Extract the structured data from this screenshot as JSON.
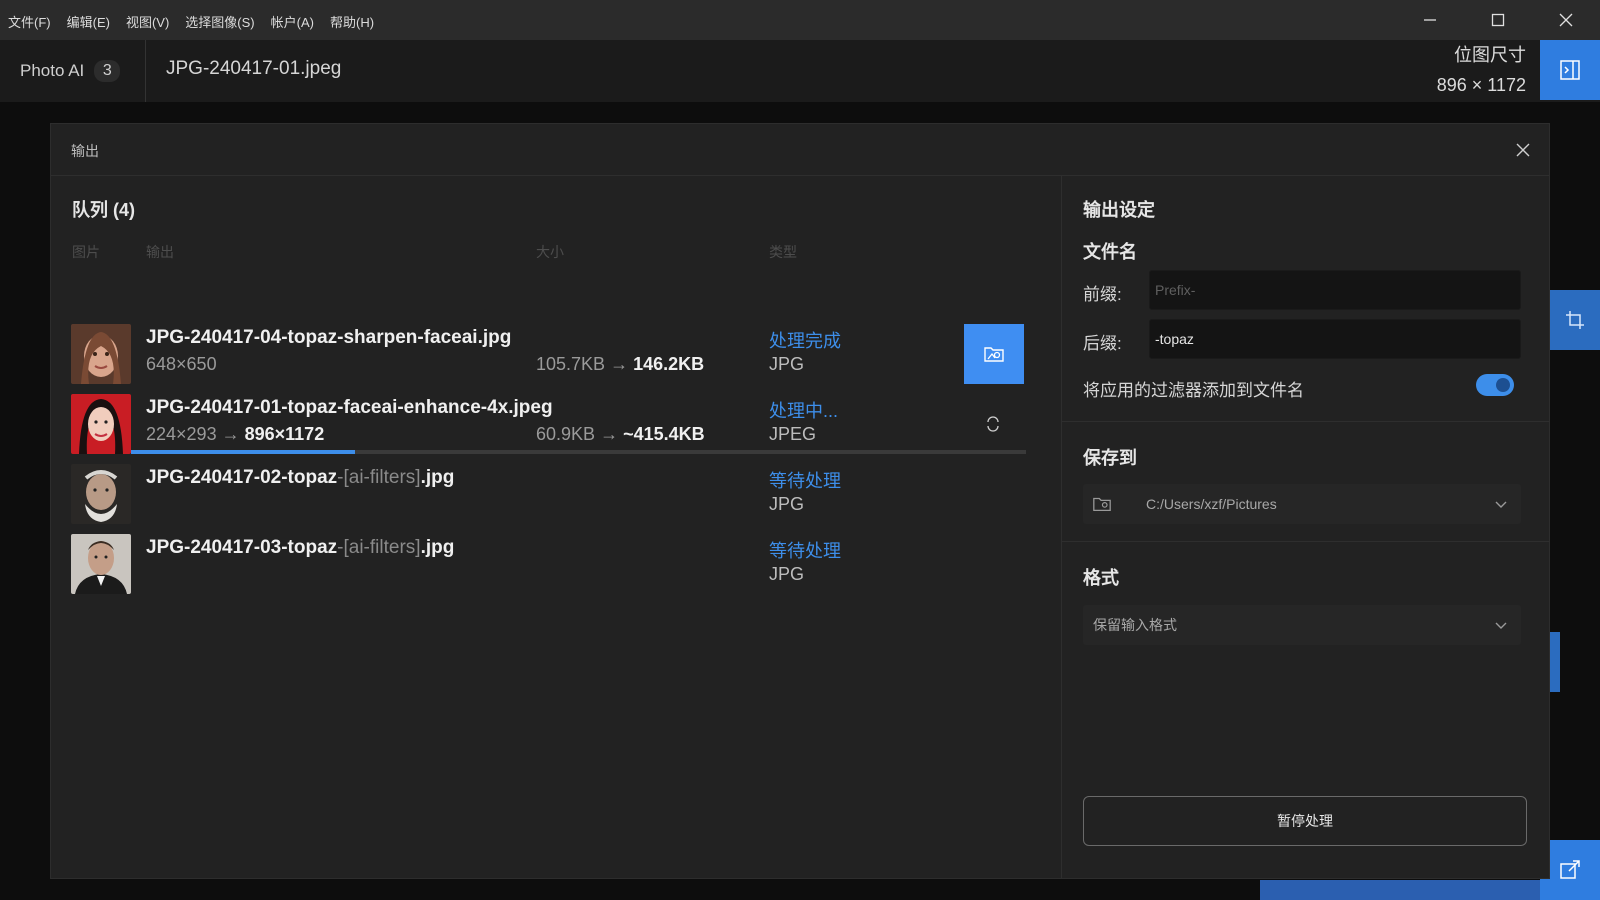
{
  "menu": [
    "文件(F)",
    "编辑(E)",
    "视图(V)",
    "选择图像(S)",
    "帐户(A)",
    "帮助(H)"
  ],
  "app": {
    "name": "Photo AI",
    "count": "3"
  },
  "file_title": "JPG-240417-01.jpeg",
  "bitmap": {
    "label": "位图尺寸",
    "value": "896 × 1172"
  },
  "dialog": {
    "title": "输出"
  },
  "queue": {
    "title": "队列 (4)",
    "columns": {
      "image": "图片",
      "output": "输出",
      "size": "大小",
      "type": "类型"
    },
    "rows": [
      {
        "name": "JPG-240417-04-topaz-sharpen-faceai.jpg",
        "name_suffix": "",
        "dims_from": "648×650",
        "dims_to": "",
        "size_from": "105.7KB",
        "size_to": "146.2KB",
        "status": "处理完成",
        "type": "JPG"
      },
      {
        "name": "JPG-240417-01-topaz-faceai-enhance-4x.jpeg",
        "name_suffix": "",
        "dims_from": "224×293",
        "dims_to": "896×1172",
        "size_from": "60.9KB",
        "size_to": "~415.4KB",
        "status": "处理中...",
        "type": "JPEG",
        "progress": 0.25
      },
      {
        "name": "JPG-240417-02-topaz",
        "name_suffix": "-[ai-filters]",
        "name_ext": ".jpg",
        "status": "等待处理",
        "type": "JPG"
      },
      {
        "name": "JPG-240417-03-topaz",
        "name_suffix": "-[ai-filters]",
        "name_ext": ".jpg",
        "status": "等待处理",
        "type": "JPG"
      }
    ]
  },
  "settings": {
    "title": "输出设定",
    "filename_title": "文件名",
    "prefix_label": "前缀:",
    "prefix_placeholder": "Prefix-",
    "suffix_label": "后缀:",
    "suffix_value": "-topaz",
    "toggle_label": "将应用的过滤器添加到文件名",
    "toggle_on": true,
    "save_title": "保存到",
    "save_path": "C:/Users/xzf/Pictures",
    "format_title": "格式",
    "format_value": "保留输入格式",
    "pause_label": "暂停处理"
  },
  "colors": {
    "accent": "#3d8eea",
    "button": "#3f8ef2"
  }
}
